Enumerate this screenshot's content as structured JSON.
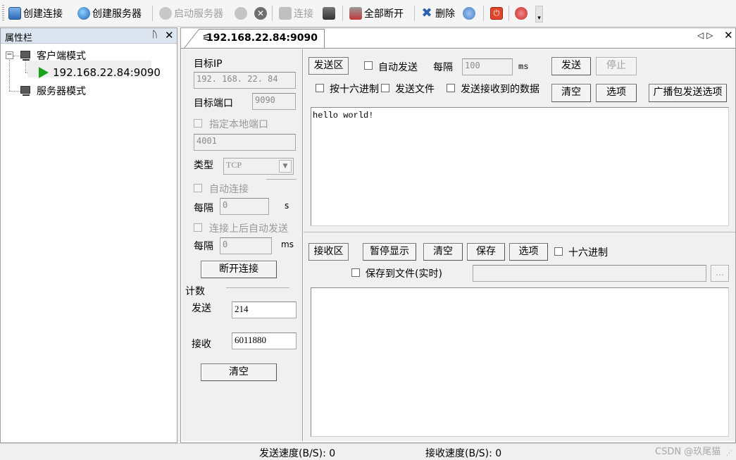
{
  "toolbar": {
    "items": [
      {
        "label": "创建连接",
        "icon": "create-connection-icon",
        "enabled": true
      },
      {
        "label": "创建服务器",
        "icon": "create-server-icon",
        "enabled": true
      },
      {
        "label": "启动服务器",
        "icon": "start-server-icon",
        "enabled": false
      },
      {
        "label": "连接",
        "icon": "connect-icon",
        "enabled": false
      },
      {
        "label": "全部断开",
        "icon": "disconnect-all-icon",
        "enabled": true
      },
      {
        "label": "删除",
        "icon": "delete-icon",
        "enabled": true
      }
    ]
  },
  "property_panel": {
    "title": "属性栏",
    "pin": "ᚢ",
    "close": "✕",
    "tree": {
      "client_mode": "客户端模式",
      "client_connection": "192.168.22.84:9090",
      "server_mode": "服务器模式",
      "collapse_glyph": "−"
    }
  },
  "document": {
    "tab_label": "192.168.22.84:9090",
    "nav": "◁▷",
    "close": "✕"
  },
  "client_form": {
    "target_ip_label": "目标IP",
    "target_ip_value": "192. 168. 22. 84",
    "target_port_label": "目标端口",
    "target_port_value": "9090",
    "local_port_label": "指定本地端口",
    "local_port_value": "4001",
    "type_label": "类型",
    "type_value": "TCP",
    "auto_connect_label": "自动连接",
    "interval_label": "每隔",
    "interval_value": "0",
    "interval_unit": "s",
    "auto_send_label": "连接上后自动发送",
    "interval2_label": "每隔",
    "interval2_value": "0",
    "interval2_unit": "ms",
    "disconnect_button": "断开连接",
    "count_label": "计数",
    "send_label": "发送",
    "send_value": "214",
    "recv_label": "接收",
    "recv_value": "6011880",
    "clear_button": "清空"
  },
  "send_area": {
    "title": "发送区",
    "auto_send_label": "自动发送",
    "interval_label": "每隔",
    "interval_value": "100",
    "unit": "ms",
    "send_button": "发送",
    "stop_button": "停止",
    "hex_label": "按十六进制",
    "send_file_label": "发送文件",
    "send_received_label": "发送接收到的数据",
    "clear_button": "清空",
    "options_button": "选项",
    "broadcast_button": "广播包发送选项",
    "content": "hello world!"
  },
  "recv_area": {
    "title": "接收区",
    "pause_button": "暂停显示",
    "clear_button": "清空",
    "save_button": "保存",
    "options_button": "选项",
    "hex_label": "十六进制",
    "save_file_label": "保存到文件(实时)",
    "browse_button": "...",
    "path_value": ""
  },
  "statusbar": {
    "send_speed": "发送速度(B/S): 0",
    "recv_speed": "接收速度(B/S): 0",
    "watermark": "CSDN @玖尾猫"
  },
  "colors": {
    "play_icon": "#1aa31a",
    "panel_header": "#dde6f0",
    "watermark": "#a8a8a8"
  }
}
